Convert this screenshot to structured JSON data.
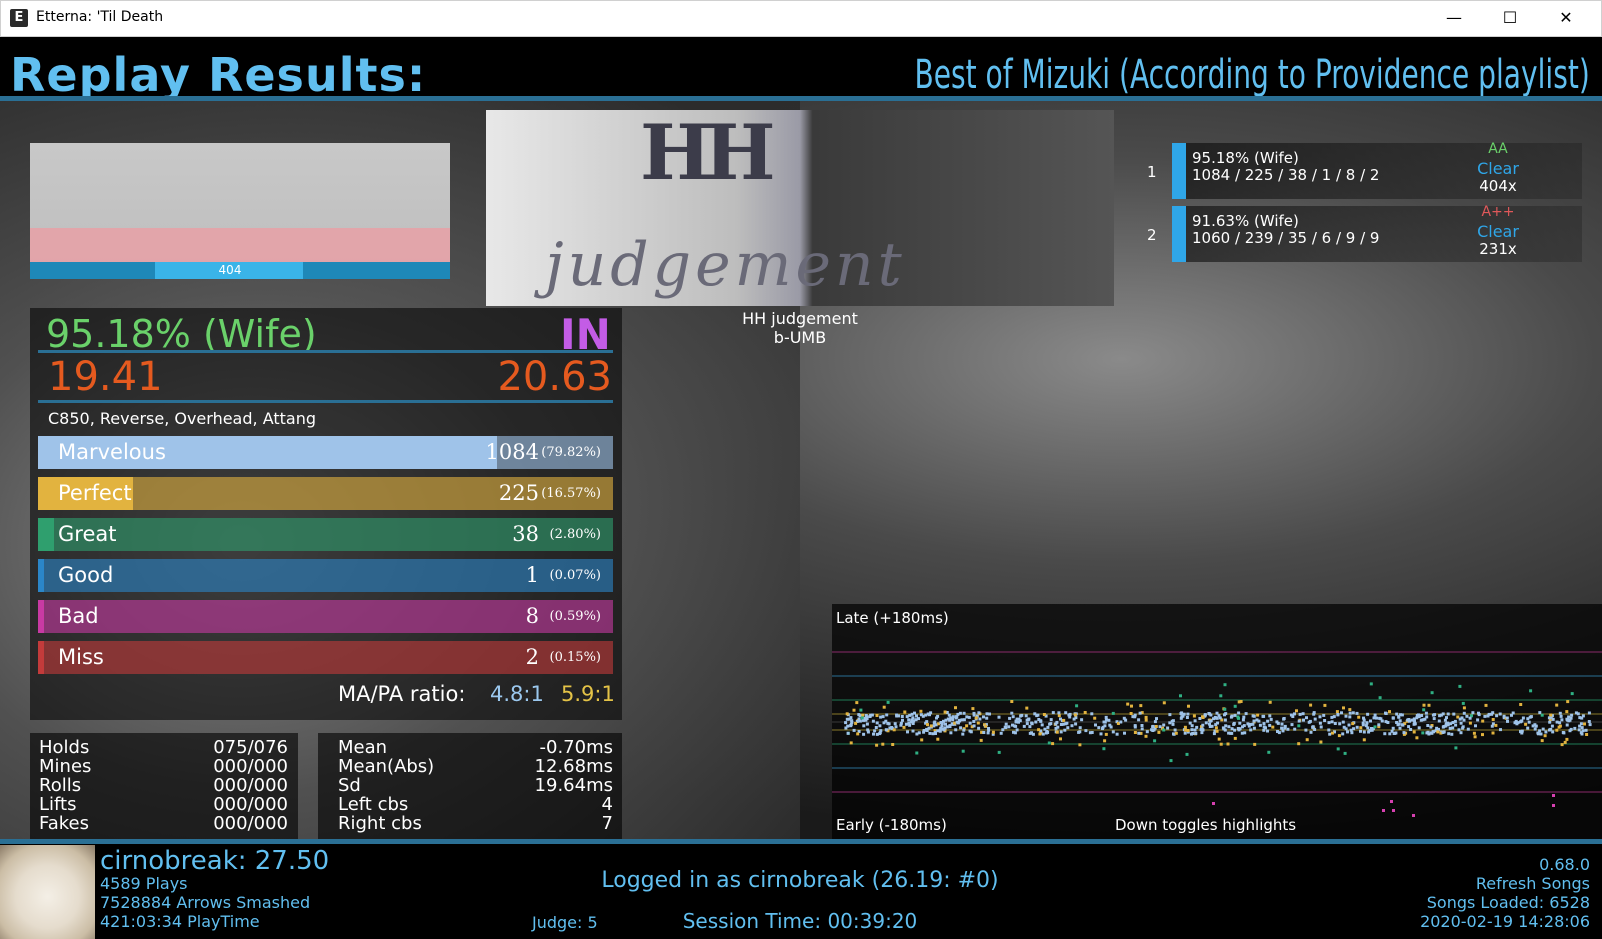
{
  "window": {
    "title": "Etterna: 'Til Death",
    "logo": "E",
    "min": "—",
    "max": "☐",
    "close": "✕"
  },
  "header": {
    "title": "Replay Results:",
    "pack": "Best of Mizuki (According to Providence playlist)"
  },
  "life_graph": {
    "combo_label": "404"
  },
  "song": {
    "title": "HH judgement",
    "artist": "b-UMB"
  },
  "score": {
    "wife": "95.18% (Wife)",
    "grade": "IN",
    "msd": "19.41",
    "ssr": "20.63",
    "mods": "C850, Reverse, Overhead, Attang"
  },
  "judgments": [
    {
      "name": "Marvelous",
      "count": "1084",
      "pct": "(79.82%)",
      "ratio": 0.7982,
      "color": "#9fc3e9"
    },
    {
      "name": "Perfect",
      "count": "225",
      "pct": "(16.57%)",
      "ratio": 0.1657,
      "color": "#e2b33f"
    },
    {
      "name": "Great",
      "count": "38",
      "pct": "(2.80%)",
      "ratio": 0.028,
      "color": "#2f9f6e"
    },
    {
      "name": "Good",
      "count": "1",
      "pct": "(0.07%)",
      "ratio": 0.0007,
      "color": "#2b86c8"
    },
    {
      "name": "Bad",
      "count": "8",
      "pct": "(0.59%)",
      "ratio": 0.0059,
      "color": "#c83aa3"
    },
    {
      "name": "Miss",
      "count": "2",
      "pct": "(0.15%)",
      "ratio": 0.0015,
      "color": "#c33b3b"
    }
  ],
  "ratio": {
    "label": "MA/PA ratio:",
    "ma": "4.8:1",
    "pa": "5.9:1"
  },
  "holds": [
    {
      "label": "Holds",
      "value": "075/076"
    },
    {
      "label": "Mines",
      "value": "000/000"
    },
    {
      "label": "Rolls",
      "value": "000/000"
    },
    {
      "label": "Lifts",
      "value": "000/000"
    },
    {
      "label": "Fakes",
      "value": "000/000"
    }
  ],
  "offsets": [
    {
      "label": "Mean",
      "value": "-0.70ms"
    },
    {
      "label": "Mean(Abs)",
      "value": "12.68ms"
    },
    {
      "label": "Sd",
      "value": "19.64ms"
    },
    {
      "label": "Left cbs",
      "value": "4"
    },
    {
      "label": "Right cbs",
      "value": "7"
    }
  ],
  "scoreboard": [
    {
      "rank": "1",
      "pct": "95.18% (Wife)",
      "judgments": "1084 / 225 / 38 / 1 / 8 / 2",
      "grade": "AA",
      "grade_color": "#6ad16a",
      "clear": "Clear",
      "combo": "404x"
    },
    {
      "rank": "2",
      "pct": "91.63% (Wife)",
      "judgments": "1060 / 239 / 35 / 6 / 9 / 9",
      "grade": "A++",
      "grade_color": "#e0585a",
      "clear": "Clear",
      "combo": "231x"
    }
  ],
  "plot": {
    "late": "Late (+180ms)",
    "early": "Early (-180ms)",
    "hint": "Down toggles highlights"
  },
  "footer": {
    "profile": "cirnobreak: 27.50",
    "plays": "4589 Plays",
    "arrows": "7528884 Arrows Smashed",
    "playtime": "421:03:34 PlayTime",
    "login": "Logged in as cirnobreak (26.19: #0)",
    "judge": "Judge: 5",
    "session": "Session Time: 00:39:20",
    "version": "0.68.0",
    "refresh": "Refresh Songs",
    "songs_loaded": "Songs Loaded: 6528",
    "datetime": "2020-02-19 14:28:06"
  }
}
